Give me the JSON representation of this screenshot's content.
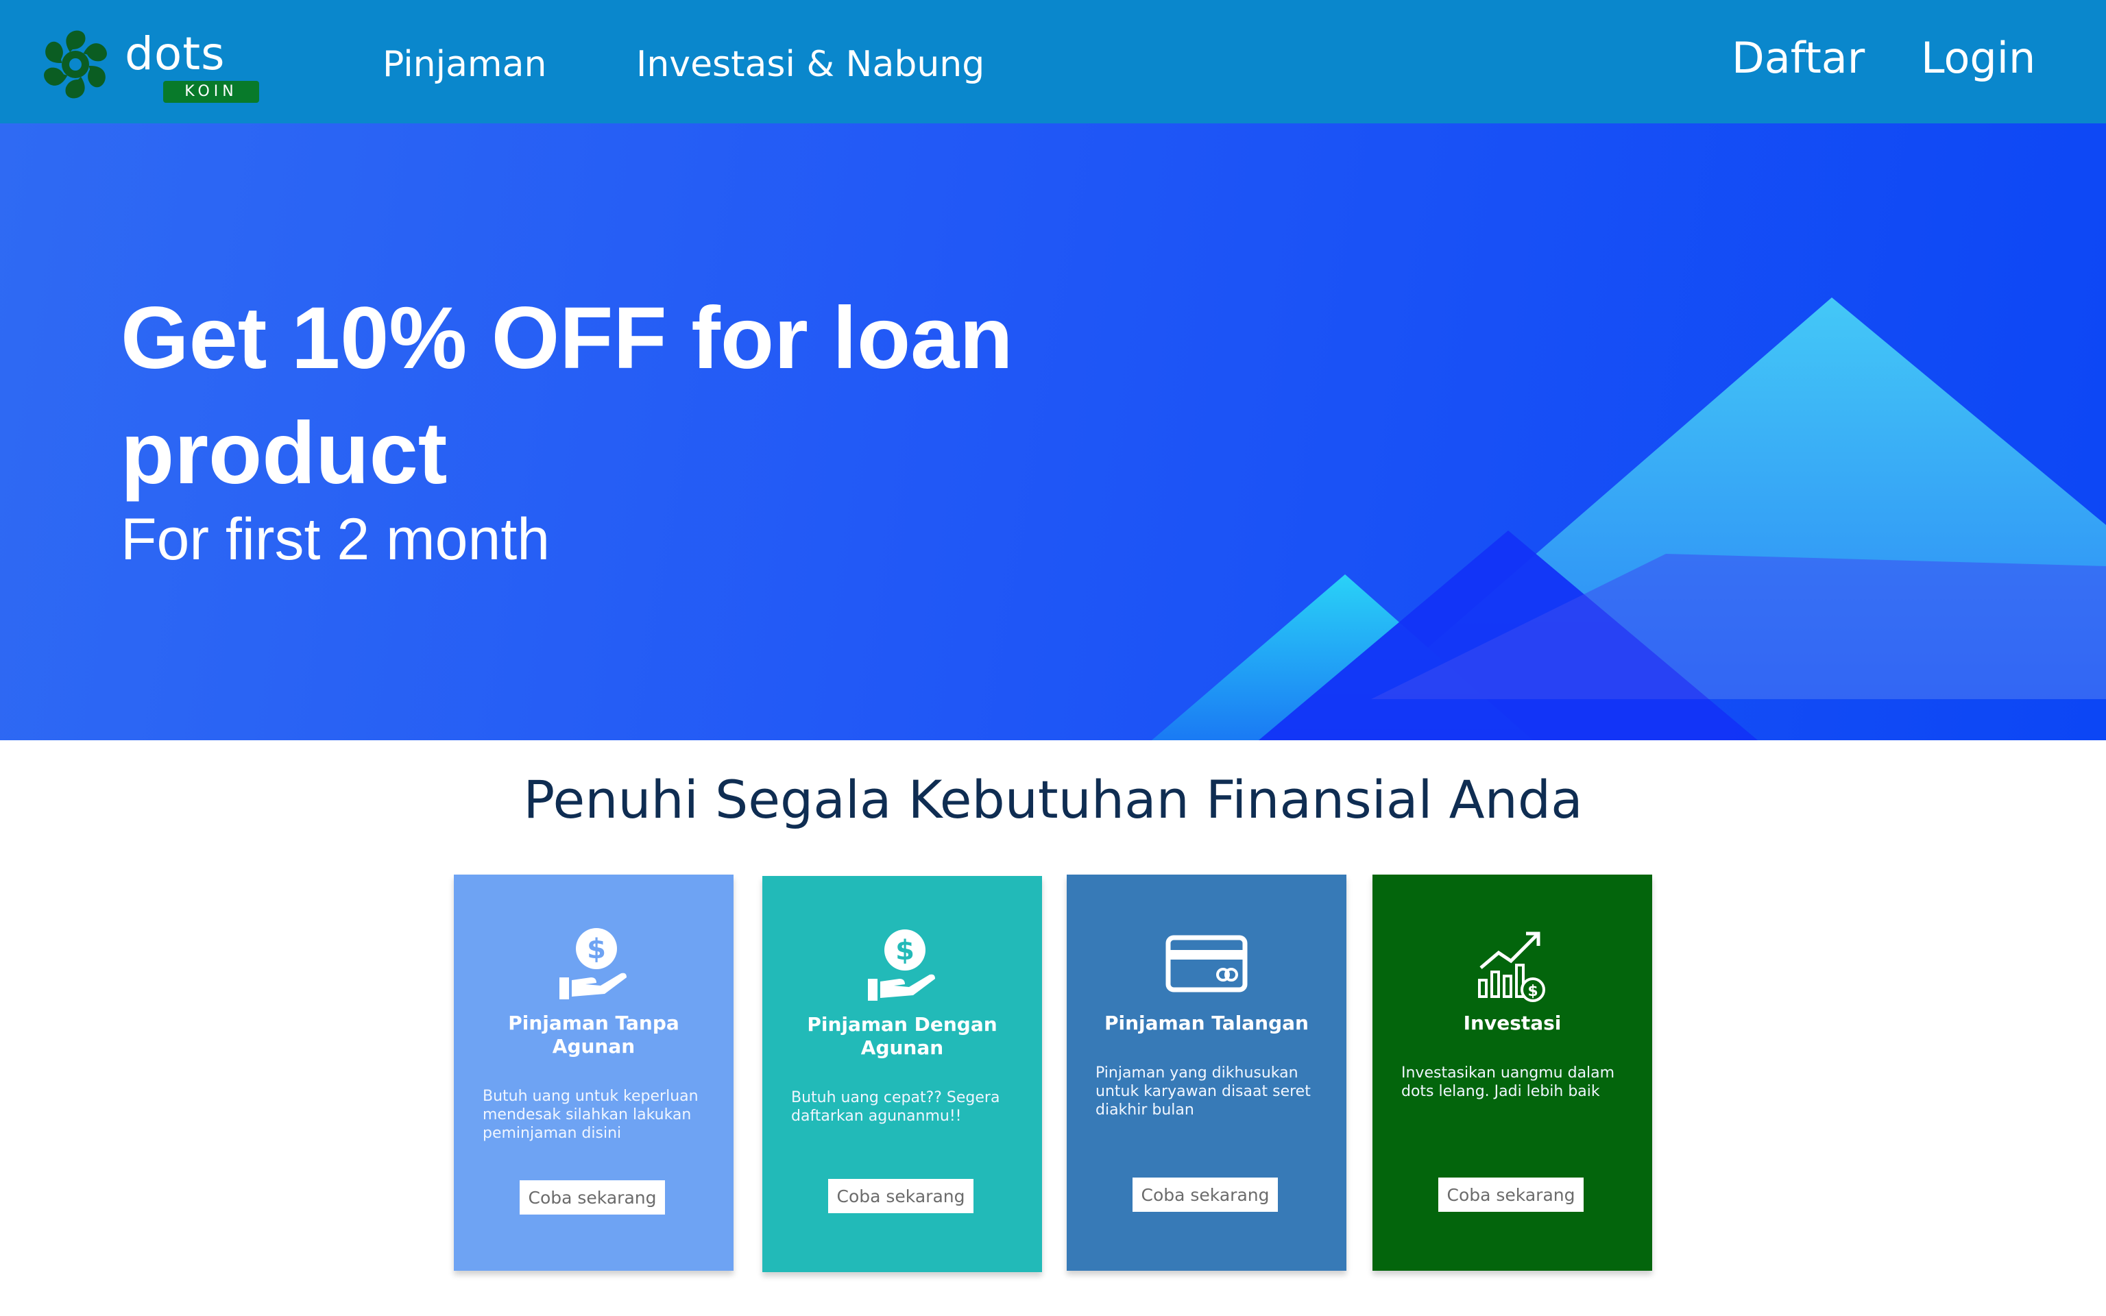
{
  "header": {
    "logo": {
      "word": "dots",
      "sub": "KOIN"
    },
    "nav": [
      {
        "label": "Pinjaman"
      },
      {
        "label": "Investasi & Nabung"
      }
    ],
    "daftar_label": "Daftar",
    "login_label": "Login"
  },
  "hero": {
    "title": "Get 10% OFF for loan product",
    "subtitle": "For first 2 month"
  },
  "section": {
    "title": "Penuhi Segala Kebutuhan Finansial Anda"
  },
  "cards": [
    {
      "icon": "hand-coin-icon",
      "title": "Pinjaman Tanpa Agunan",
      "desc": "Butuh uang untuk keperluan mendesak silahkan lakukan peminjaman disini",
      "button": "Coba sekarang",
      "color": "#6ea3f3"
    },
    {
      "icon": "hand-coin-icon",
      "title": "Pinjaman Dengan Agunan",
      "desc": "Butuh uang cepat?? Segera daftarkan agunanmu!!",
      "button": "Coba sekarang",
      "color": "#22bab8"
    },
    {
      "icon": "credit-card-icon",
      "title": "Pinjaman Talangan",
      "desc": "Pinjaman yang dikhusukan untuk karyawan disaat seret diakhir bulan",
      "button": "Coba sekarang",
      "color": "#377ab7"
    },
    {
      "icon": "growth-chart-icon",
      "title": "Investasi",
      "desc": "Investasikan uangmu dalam dots lelang. Jadi lebih baik",
      "button": "Coba sekarang",
      "color": "#03650c"
    }
  ],
  "colors": {
    "header_bg": "#0a87cc",
    "hero_bg": "#2158f6",
    "section_title": "#0f2d52"
  }
}
